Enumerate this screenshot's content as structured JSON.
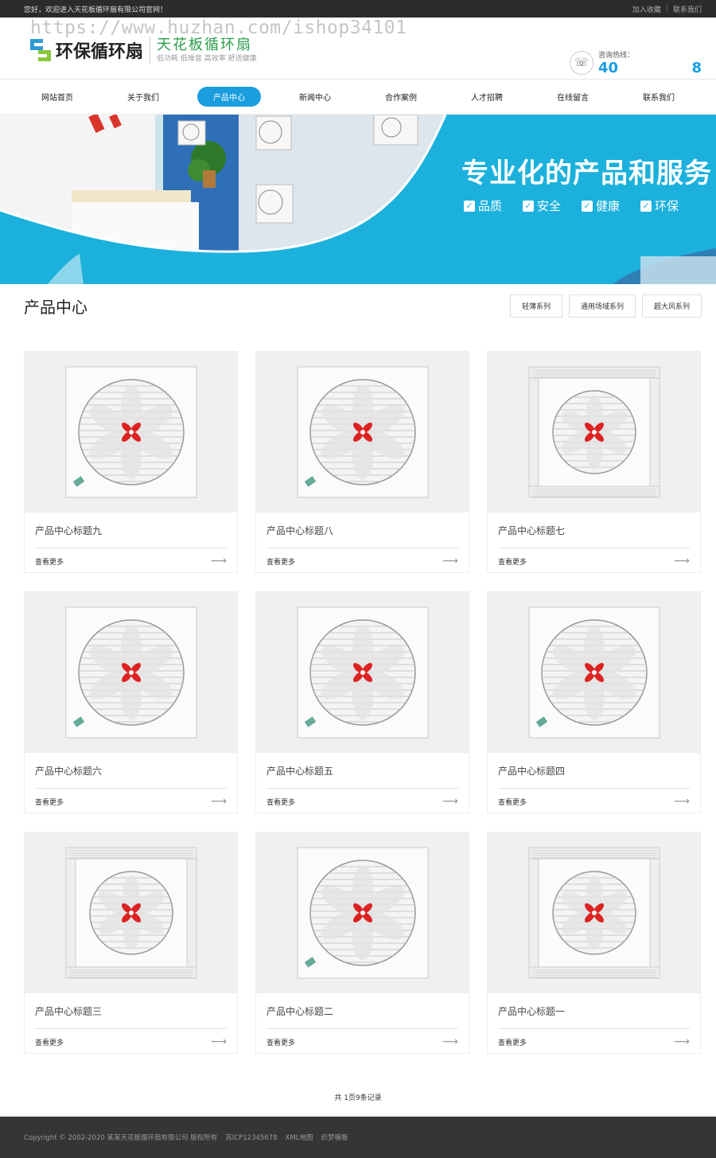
{
  "topbar": {
    "welcome": "您好，欢迎进入天花板循环扇有限公司官网！",
    "add_favorite": "加入收藏",
    "contact": "联系我们"
  },
  "header": {
    "watermark": "https://www.huzhan.com/ishop34101",
    "logo_name": "环保循环扇",
    "logo_slogan": "天花板循环扇",
    "logo_tagline": "低功耗 低噪音 高效率 舒适健康",
    "hotline_label": "咨询热线：",
    "hotline_number_start": "40",
    "hotline_number_end": "8"
  },
  "nav": {
    "items": [
      "网站首页",
      "关于我们",
      "产品中心",
      "新闻中心",
      "合作案例",
      "人才招聘",
      "在线留言",
      "联系我们"
    ],
    "active_index": 2
  },
  "banner": {
    "title": "专业化的产品和服务",
    "features": [
      "品质",
      "安全",
      "健康",
      "环保"
    ]
  },
  "section": {
    "title": "产品中心",
    "categories": [
      "轻薄系列",
      "通用场域系列",
      "超大风系列"
    ]
  },
  "products": [
    {
      "title": "产品中心标题九",
      "more": "查看更多",
      "style": "square"
    },
    {
      "title": "产品中心标题八",
      "more": "查看更多",
      "style": "square"
    },
    {
      "title": "产品中心标题七",
      "more": "查看更多",
      "style": "vent"
    },
    {
      "title": "产品中心标题六",
      "more": "查看更多",
      "style": "square"
    },
    {
      "title": "产品中心标题五",
      "more": "查看更多",
      "style": "square"
    },
    {
      "title": "产品中心标题四",
      "more": "查看更多",
      "style": "square"
    },
    {
      "title": "产品中心标题三",
      "more": "查看更多",
      "style": "vent"
    },
    {
      "title": "产品中心标题二",
      "more": "查看更多",
      "style": "square"
    },
    {
      "title": "产品中心标题一",
      "more": "查看更多",
      "style": "vent"
    }
  ],
  "pager": {
    "text": "共 1页9条记录"
  },
  "footer": {
    "copyright": "Copyright © 2002-2020 某某天花板循环扇有限公司 版权所有",
    "icp": "苏ICP12345678",
    "xml_map": "XML地图",
    "template": "织梦模板"
  },
  "colors": {
    "accent": "#1a9ee0",
    "banner": "#1bb1dc",
    "footer": "#353535"
  }
}
